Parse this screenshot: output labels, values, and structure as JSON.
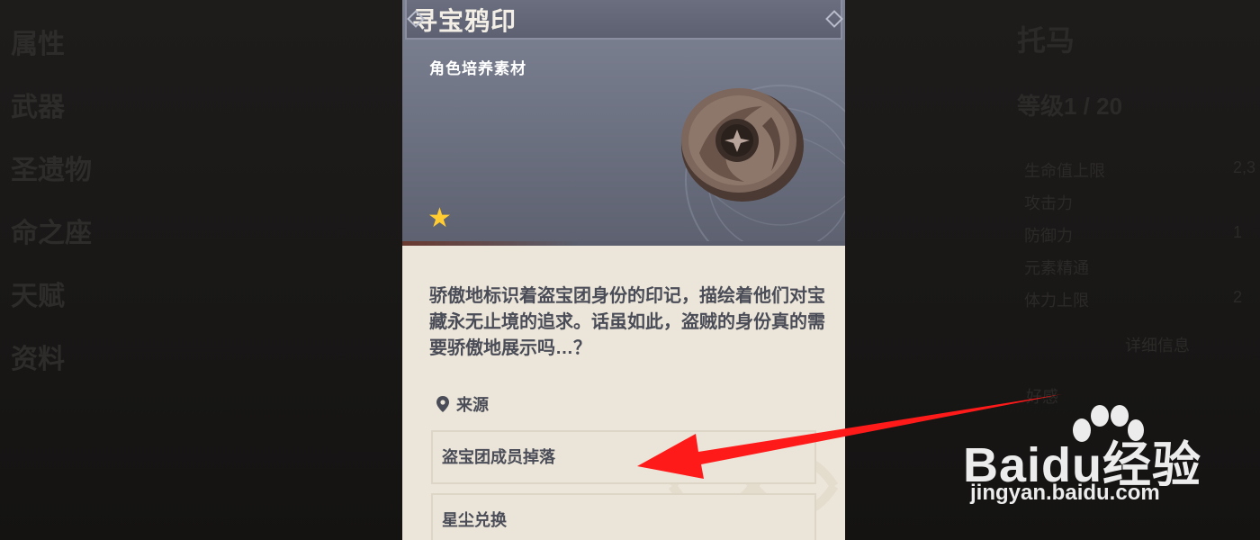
{
  "left_menu": {
    "items": [
      "属性",
      "武器",
      "圣遗物",
      "命之座",
      "天赋",
      "资料"
    ]
  },
  "right_panel": {
    "character_name": "托马",
    "level": "等级1 / 20",
    "stats": [
      {
        "label": "生命值上限",
        "value": "2,3"
      },
      {
        "label": "攻击力",
        "value": ""
      },
      {
        "label": "防御力",
        "value": "1"
      },
      {
        "label": "元素精通",
        "value": ""
      },
      {
        "label": "体力上限",
        "value": "2"
      }
    ],
    "details_button": "详细信息",
    "favorite": "好感"
  },
  "card": {
    "title": "寻宝鸦印",
    "category": "角色培养素材",
    "rarity_stars": 1,
    "star_color": "#ffcc32",
    "description": "骄傲地标识着盗宝团身份的印记，描绘着他们对宝藏永无止境的追求。话虽如此，盗贼的身份真的需要骄傲地展示吗…？",
    "source_heading": "来源",
    "source_icon": "location-pin-icon",
    "sources": [
      "盗宝团成员掉落",
      "星尘兑换"
    ]
  },
  "annotation": {
    "arrow_color": "#ff1a1a",
    "arrow_target": "盗宝团成员掉落"
  },
  "watermark": {
    "brand": "Baidu经验",
    "url": "jingyan.baidu.com"
  }
}
